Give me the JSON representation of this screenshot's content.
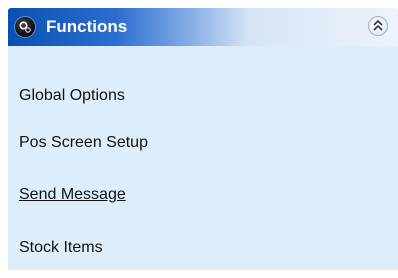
{
  "panel": {
    "title": "Functions",
    "icon": "functions-gear-icon",
    "collapse_icon": "double-chevron-up-icon",
    "items": [
      {
        "label": "Global Options"
      },
      {
        "label": "Pos Screen Setup"
      },
      {
        "label": "Send Message",
        "state": "hovered"
      },
      {
        "label": "Stock Items"
      }
    ]
  },
  "colors": {
    "header_start": "#0a4fb3",
    "header_end": "#eef3fb",
    "body_bg": "#ddeefa",
    "item_text": "#111111",
    "title_text": "#ffffff"
  }
}
